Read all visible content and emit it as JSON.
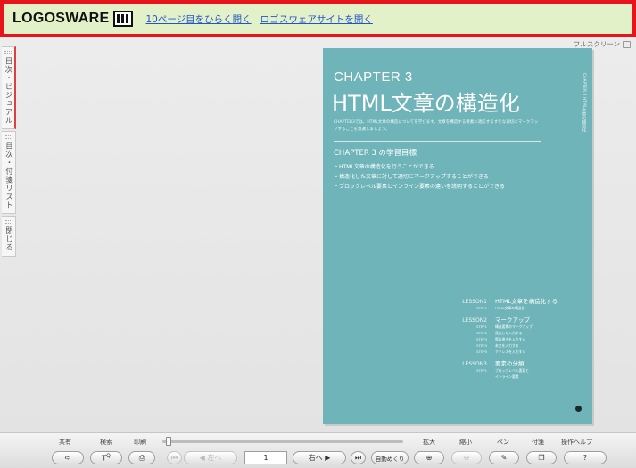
{
  "header": {
    "logo_text": "LOGOSWARE",
    "link_page10": "10ページ目をひらく",
    "link_open": "開く",
    "link_site": "ロゴスウェアサイトを開く"
  },
  "viewer": {
    "fullscreen_label": "フルスクリーン",
    "side_tabs": [
      {
        "label": "目次・ビジュアル"
      },
      {
        "label": "目次・付箋リスト"
      },
      {
        "label": "閉じる"
      }
    ]
  },
  "page": {
    "chapter_label": "CHAPTER 3",
    "title": "HTML文章の構造化",
    "intro": "CHAPTER3では、HTML文章の構造についてを学びます。文章を構造する要素に適応するすをな適切にマークアップすることを意識しましょう。",
    "spine_text": "CHAPTER 3 HTML文章の構造化",
    "goals_title": "CHAPTER 3 の学習目標",
    "goals": [
      "・HTML文章の構造化を行うことができる",
      "・構造化した文章に対して適切にマークアップすることができる",
      "・ブロックレベル要素とインライン要素の違いを説明することができる"
    ],
    "lessons": [
      {
        "key": "LESSON1",
        "title": "HTML文章を構造化する",
        "steps": [
          {
            "key": "STEP1",
            "text": "HTML文章の構造化"
          }
        ]
      },
      {
        "key": "LESSON2",
        "title": "マークアップ",
        "steps": [
          {
            "key": "STEP1",
            "text": "構造要素のマークアップ"
          },
          {
            "key": "STEP2",
            "text": "見出しを入力する"
          },
          {
            "key": "STEP3",
            "text": "箇条書きを入力する"
          },
          {
            "key": "STEP4",
            "text": "本文を入力する"
          },
          {
            "key": "STEP5",
            "text": "アドレスを入力する"
          }
        ]
      },
      {
        "key": "LESSON3",
        "title": "要素の分類",
        "steps": [
          {
            "key": "STEP1",
            "text": "ブロックレベル要素と"
          },
          {
            "key": "",
            "text": "インライン要素"
          }
        ]
      }
    ]
  },
  "toolbar": {
    "share": "共有",
    "search": "検索",
    "print": "印刷",
    "zoom_in_label": "拡大",
    "zoom_out_label": "縮小",
    "pen": "ペン",
    "sticky": "付箋",
    "help": "操作ヘルプ",
    "left_btn": "左へ",
    "page_number": "1",
    "right_btn": "右へ",
    "auto_flip": "自動めくり"
  }
}
